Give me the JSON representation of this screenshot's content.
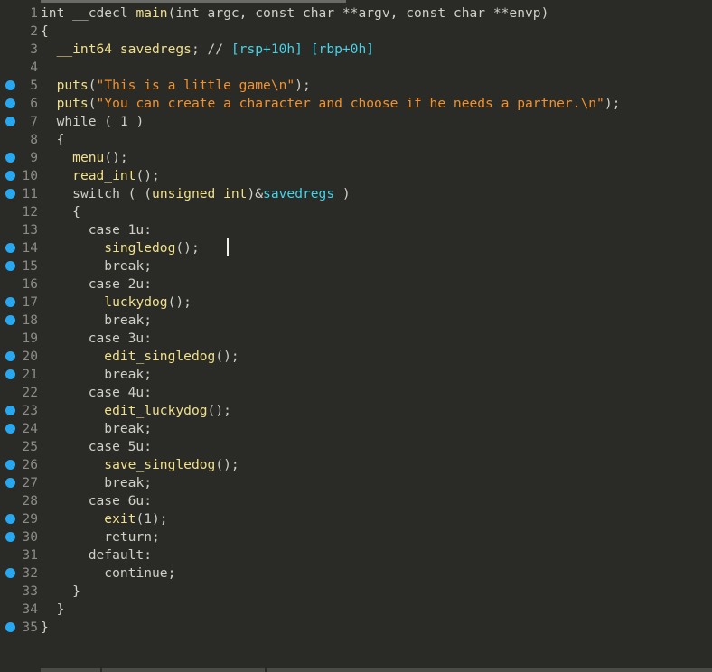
{
  "lines": [
    {
      "num": "1",
      "bp": false,
      "indent": "",
      "tokens": [
        [
          "kw",
          "int __cdecl "
        ],
        [
          "fn",
          "main"
        ],
        [
          "pl",
          "("
        ],
        [
          "kw",
          "int argc, const char **argv, const char **envp"
        ],
        [
          "pl",
          ")"
        ]
      ]
    },
    {
      "num": "2",
      "bp": false,
      "indent": "",
      "tokens": [
        [
          "pl",
          "{"
        ]
      ]
    },
    {
      "num": "3",
      "bp": false,
      "indent": "  ",
      "tokens": [
        [
          "fn",
          "__int64 savedregs"
        ],
        [
          "pl",
          "; // "
        ],
        [
          "cy",
          "[rsp+10h] [rbp+0h]"
        ]
      ]
    },
    {
      "num": "4",
      "bp": false,
      "indent": "",
      "tokens": []
    },
    {
      "num": "5",
      "bp": true,
      "indent": "  ",
      "tokens": [
        [
          "fn",
          "puts"
        ],
        [
          "pl",
          "("
        ],
        [
          "str",
          "\"This is a little game\\n\""
        ],
        [
          "pl",
          ");"
        ]
      ]
    },
    {
      "num": "6",
      "bp": true,
      "indent": "  ",
      "tokens": [
        [
          "fn",
          "puts"
        ],
        [
          "pl",
          "("
        ],
        [
          "str",
          "\"You can create a character and choose if he needs a partner.\\n\""
        ],
        [
          "pl",
          ");"
        ]
      ]
    },
    {
      "num": "7",
      "bp": true,
      "indent": "  ",
      "tokens": [
        [
          "kw",
          "while ( 1 )"
        ]
      ]
    },
    {
      "num": "8",
      "bp": false,
      "indent": "  ",
      "tokens": [
        [
          "pl",
          "{"
        ]
      ]
    },
    {
      "num": "9",
      "bp": true,
      "indent": "    ",
      "tokens": [
        [
          "fn",
          "menu"
        ],
        [
          "pl",
          "();"
        ]
      ]
    },
    {
      "num": "10",
      "bp": true,
      "indent": "    ",
      "tokens": [
        [
          "fn",
          "read_int"
        ],
        [
          "pl",
          "();"
        ]
      ]
    },
    {
      "num": "11",
      "bp": true,
      "indent": "    ",
      "tokens": [
        [
          "kw",
          "switch ( ("
        ],
        [
          "fn",
          "unsigned int"
        ],
        [
          "pl",
          ")&"
        ],
        [
          "cy",
          "savedregs"
        ],
        [
          "kw",
          " )"
        ]
      ]
    },
    {
      "num": "12",
      "bp": false,
      "indent": "    ",
      "tokens": [
        [
          "pl",
          "{"
        ]
      ]
    },
    {
      "num": "13",
      "bp": false,
      "indent": "      ",
      "tokens": [
        [
          "kw",
          "case 1u:"
        ]
      ]
    },
    {
      "num": "14",
      "bp": true,
      "indent": "        ",
      "tokens": [
        [
          "fn",
          "singledog"
        ],
        [
          "pl",
          "();"
        ]
      ]
    },
    {
      "num": "15",
      "bp": true,
      "indent": "        ",
      "tokens": [
        [
          "kw",
          "break;"
        ]
      ]
    },
    {
      "num": "16",
      "bp": false,
      "indent": "      ",
      "tokens": [
        [
          "kw",
          "case 2u:"
        ]
      ]
    },
    {
      "num": "17",
      "bp": true,
      "indent": "        ",
      "tokens": [
        [
          "fn",
          "luckydog"
        ],
        [
          "pl",
          "();"
        ]
      ]
    },
    {
      "num": "18",
      "bp": true,
      "indent": "        ",
      "tokens": [
        [
          "kw",
          "break;"
        ]
      ]
    },
    {
      "num": "19",
      "bp": false,
      "indent": "      ",
      "tokens": [
        [
          "kw",
          "case 3u:"
        ]
      ]
    },
    {
      "num": "20",
      "bp": true,
      "indent": "        ",
      "tokens": [
        [
          "fn",
          "edit_singledog"
        ],
        [
          "pl",
          "();"
        ]
      ]
    },
    {
      "num": "21",
      "bp": true,
      "indent": "        ",
      "tokens": [
        [
          "kw",
          "break;"
        ]
      ]
    },
    {
      "num": "22",
      "bp": false,
      "indent": "      ",
      "tokens": [
        [
          "kw",
          "case 4u:"
        ]
      ]
    },
    {
      "num": "23",
      "bp": true,
      "indent": "        ",
      "tokens": [
        [
          "fn",
          "edit_luckydog"
        ],
        [
          "pl",
          "();"
        ]
      ]
    },
    {
      "num": "24",
      "bp": true,
      "indent": "        ",
      "tokens": [
        [
          "kw",
          "break;"
        ]
      ]
    },
    {
      "num": "25",
      "bp": false,
      "indent": "      ",
      "tokens": [
        [
          "kw",
          "case 5u:"
        ]
      ]
    },
    {
      "num": "26",
      "bp": true,
      "indent": "        ",
      "tokens": [
        [
          "fn",
          "save_singledog"
        ],
        [
          "pl",
          "();"
        ]
      ]
    },
    {
      "num": "27",
      "bp": true,
      "indent": "        ",
      "tokens": [
        [
          "kw",
          "break;"
        ]
      ]
    },
    {
      "num": "28",
      "bp": false,
      "indent": "      ",
      "tokens": [
        [
          "kw",
          "case 6u:"
        ]
      ]
    },
    {
      "num": "29",
      "bp": true,
      "indent": "        ",
      "tokens": [
        [
          "fn",
          "exit"
        ],
        [
          "pl",
          "(1);"
        ]
      ]
    },
    {
      "num": "30",
      "bp": true,
      "indent": "        ",
      "tokens": [
        [
          "kw",
          "return;"
        ]
      ]
    },
    {
      "num": "31",
      "bp": false,
      "indent": "      ",
      "tokens": [
        [
          "kw",
          "default:"
        ]
      ]
    },
    {
      "num": "32",
      "bp": true,
      "indent": "        ",
      "tokens": [
        [
          "kw",
          "continue;"
        ]
      ]
    },
    {
      "num": "33",
      "bp": false,
      "indent": "    ",
      "tokens": [
        [
          "pl",
          "}"
        ]
      ]
    },
    {
      "num": "34",
      "bp": false,
      "indent": "  ",
      "tokens": [
        [
          "pl",
          "}"
        ]
      ]
    },
    {
      "num": "35",
      "bp": true,
      "indent": "",
      "tokens": [
        [
          "pl",
          "}"
        ]
      ]
    }
  ],
  "colors": {
    "background": "#2a2a26",
    "breakpoint": "#27a8f0",
    "line_number": "#8c8c86",
    "keyword": "#d0d0c8",
    "function": "#f0e08c",
    "string": "#f2922e",
    "variable": "#45d3e8"
  }
}
